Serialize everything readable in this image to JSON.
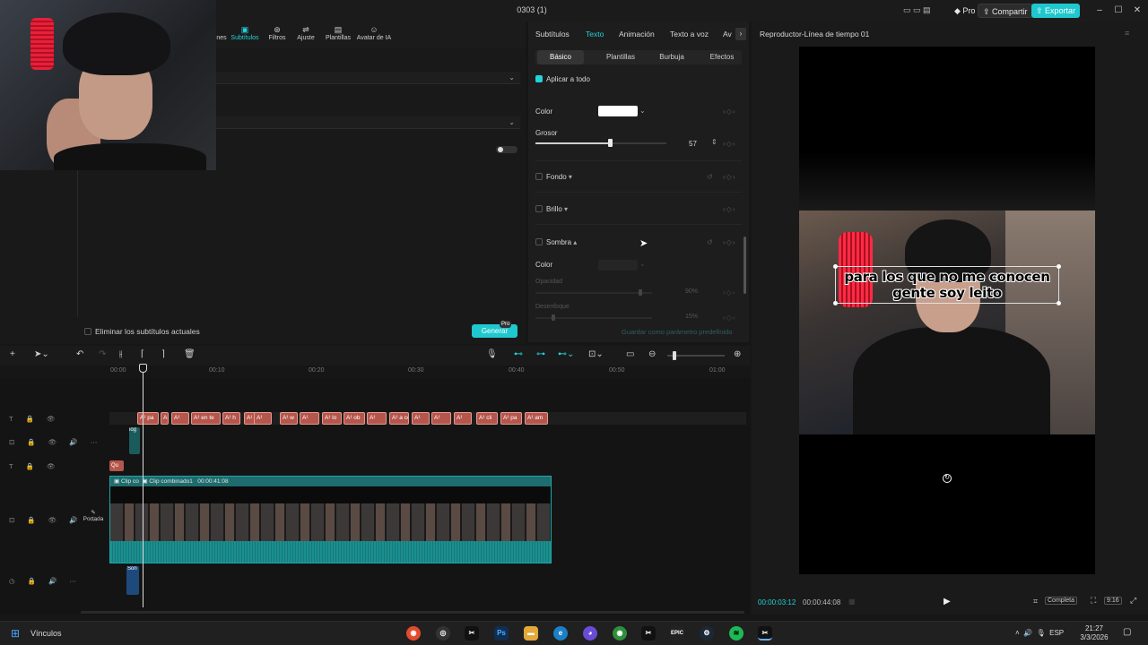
{
  "window": {
    "title": "0303 (1)",
    "pro_label": "Pro",
    "share_label": "Compartir",
    "export_label": "Exportar",
    "minimize_icon": "minimize-icon",
    "maximize_icon": "maximize-icon",
    "close_icon": "close-icon"
  },
  "toolbar": {
    "items": [
      {
        "label": "nes",
        "icon": "effects-icon"
      },
      {
        "label": "Subtítulos",
        "icon": "subtitles-icon",
        "active": true
      },
      {
        "label": "Filtros",
        "icon": "filters-icon"
      },
      {
        "label": "Ajuste",
        "icon": "adjust-icon"
      },
      {
        "label": "Plantillas",
        "icon": "templates-icon"
      },
      {
        "label": "Avatar de IA",
        "icon": "ai-avatar-icon"
      }
    ]
  },
  "left_panel": {
    "remove_subtitles_label": "Eliminar los subtítulos actuales",
    "generate_label": "Generar",
    "generate_badge": "Pro"
  },
  "properties": {
    "tabs": [
      "Subtítulos",
      "Texto",
      "Animación",
      "Texto a voz",
      "Av"
    ],
    "active_tab": "Texto",
    "subtabs": [
      "Básico",
      "Plantillas",
      "Burbuja",
      "Efectos"
    ],
    "active_subtab": "Básico",
    "apply_all_label": "Aplicar a todo",
    "color_label": "Color",
    "color_value": "#ffffff",
    "stroke_label": "Grosor",
    "stroke_value": "57",
    "stroke_fraction": 0.57,
    "background_label": "Fondo",
    "brightness_label": "Brillo",
    "shadow_label": "Sombra",
    "shadow_color_label": "Color",
    "opacity_label": "Opacidad",
    "opacity_value": "90%",
    "opacity_fraction": 0.9,
    "blur_label": "Desenfoque",
    "blur_value": "15%",
    "blur_fraction": 0.15,
    "save_default_label": "Guardar como parámetro predefinido"
  },
  "player": {
    "title": "Reproductor-Línea de tiempo 01",
    "caption": "para los que no me conocen gente soy leito",
    "current_time": "00:00:03:12",
    "total_time": "00:00:44:08",
    "full_label": "Completa",
    "ratio_label": "9:16"
  },
  "timeline": {
    "ticks": [
      "00:00",
      "00:10",
      "00:20",
      "00:30",
      "00:40",
      "00:50",
      "01:00"
    ],
    "text_clips": [
      "A¹ pa",
      "A¹",
      "A¹",
      "A¹ en te",
      "A¹ h",
      "A¹ fie",
      "A¹",
      "A¹ w",
      "A¹",
      "A¹ lo",
      "A¹ ob",
      "A¹",
      "A¹ a co",
      "A¹",
      "A¹",
      "A¹",
      "A¹ cli",
      "A¹ pa",
      "A¹ am"
    ],
    "sticker_clip": "log",
    "small_clip": "Qu",
    "video_clip_a": "Clip co",
    "video_clip_b": "Clip combinado1",
    "video_clip_duration": "00:00:41:08",
    "cover_label": "Portada",
    "audio_clip": "Son"
  },
  "taskbar": {
    "links_label": "Vínculos",
    "lang": "ESP",
    "time": "21:27",
    "date": "3/3/2026"
  },
  "colors": {
    "accent": "#1fc8cf",
    "text_clip": "#b5564c",
    "video_clip": "#1e6c6d"
  }
}
